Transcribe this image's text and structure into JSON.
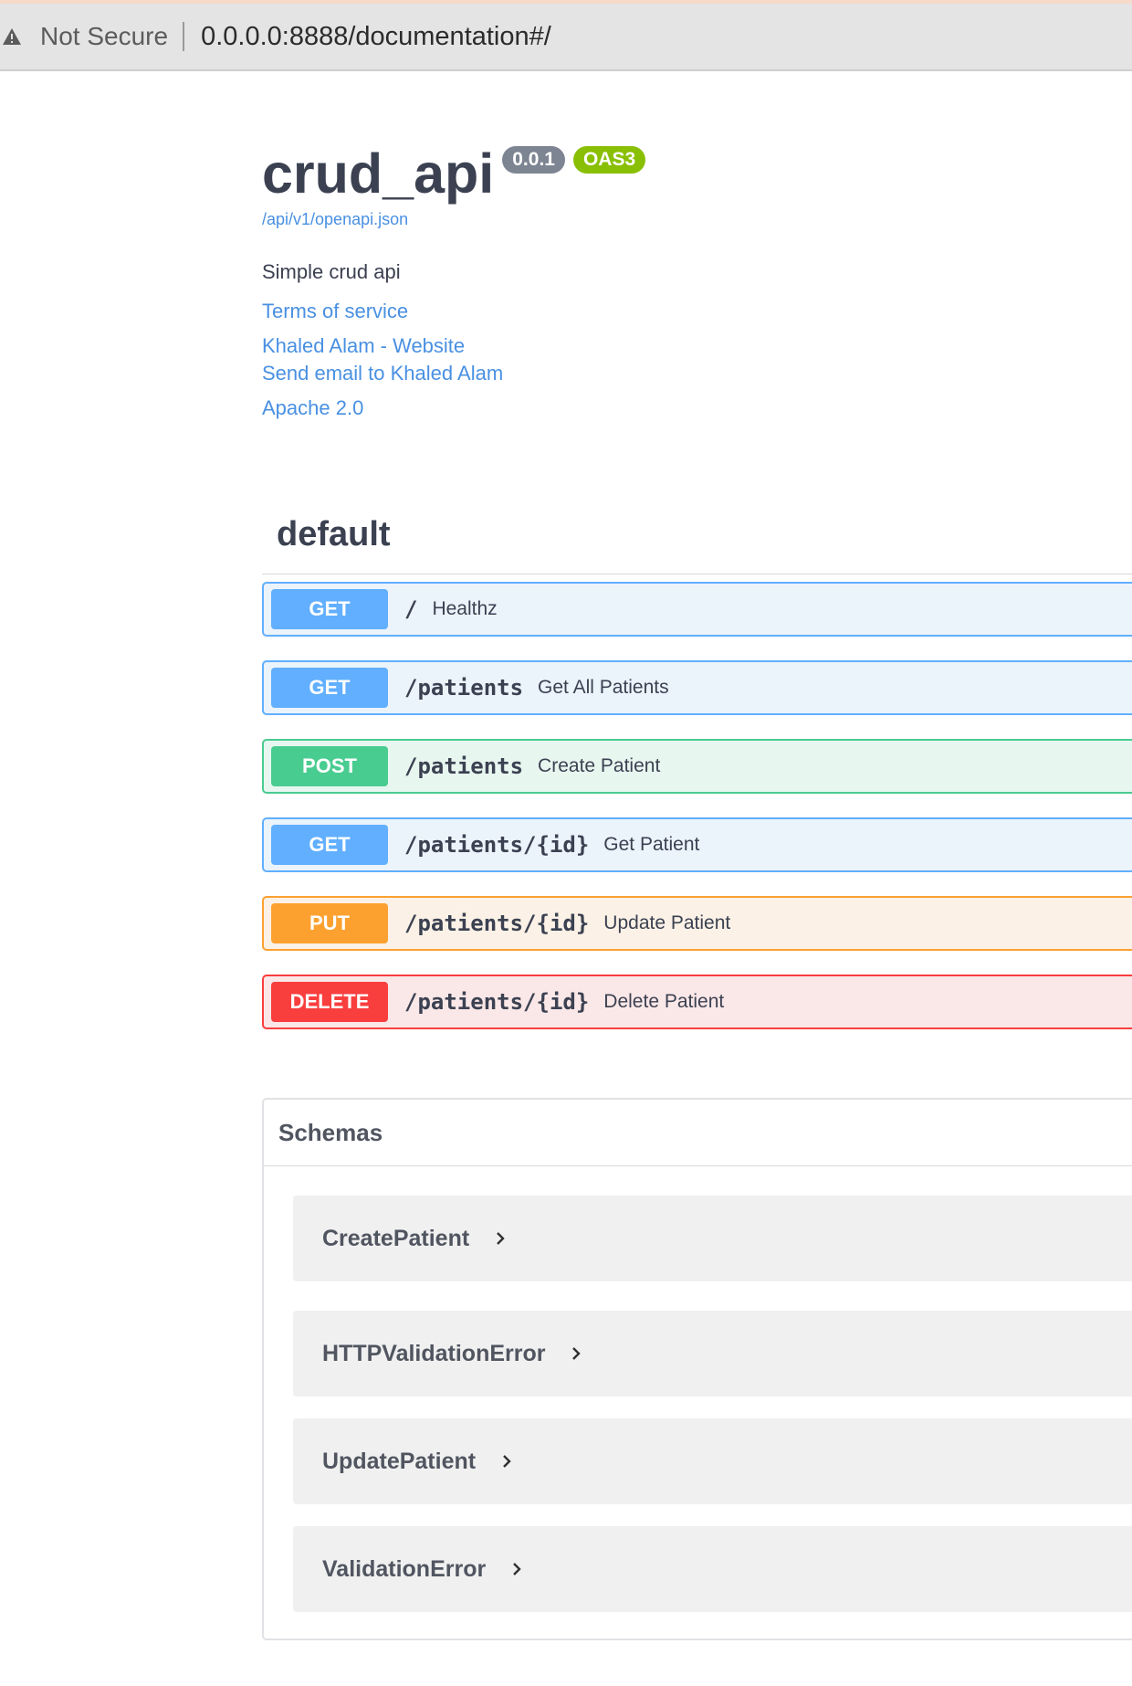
{
  "browser": {
    "security_label": "Not Secure",
    "url": "0.0.0.0:8888/documentation#/"
  },
  "info": {
    "title": "crud_api",
    "version": "0.0.1",
    "oas_badge": "OAS3",
    "spec_url": "/api/v1/openapi.json",
    "description": "Simple crud api",
    "terms_link": "Terms of service",
    "website_link": "Khaled Alam - Website",
    "email_link": "Send email to Khaled Alam",
    "license_link": "Apache 2.0"
  },
  "section": {
    "title": "default"
  },
  "operations": [
    {
      "method": "GET",
      "path": "/",
      "summary": "Healthz"
    },
    {
      "method": "GET",
      "path": "/patients",
      "summary": "Get All Patients"
    },
    {
      "method": "POST",
      "path": "/patients",
      "summary": "Create Patient"
    },
    {
      "method": "GET",
      "path": "/patients/{id}",
      "summary": "Get Patient"
    },
    {
      "method": "PUT",
      "path": "/patients/{id}",
      "summary": "Update Patient"
    },
    {
      "method": "DELETE",
      "path": "/patients/{id}",
      "summary": "Delete Patient"
    }
  ],
  "schemas": {
    "title": "Schemas",
    "models": [
      "CreatePatient",
      "HTTPValidationError",
      "UpdatePatient",
      "ValidationError"
    ]
  },
  "colors": {
    "get": "#61affe",
    "post": "#49cc90",
    "put": "#fca130",
    "delete": "#f93e3e",
    "link": "#4990e2",
    "oas_badge": "#89bf04",
    "version_badge": "#7d8492"
  },
  "icons": {
    "security": "warning-triangle-icon",
    "model_toggle": "chevron-right-icon"
  }
}
